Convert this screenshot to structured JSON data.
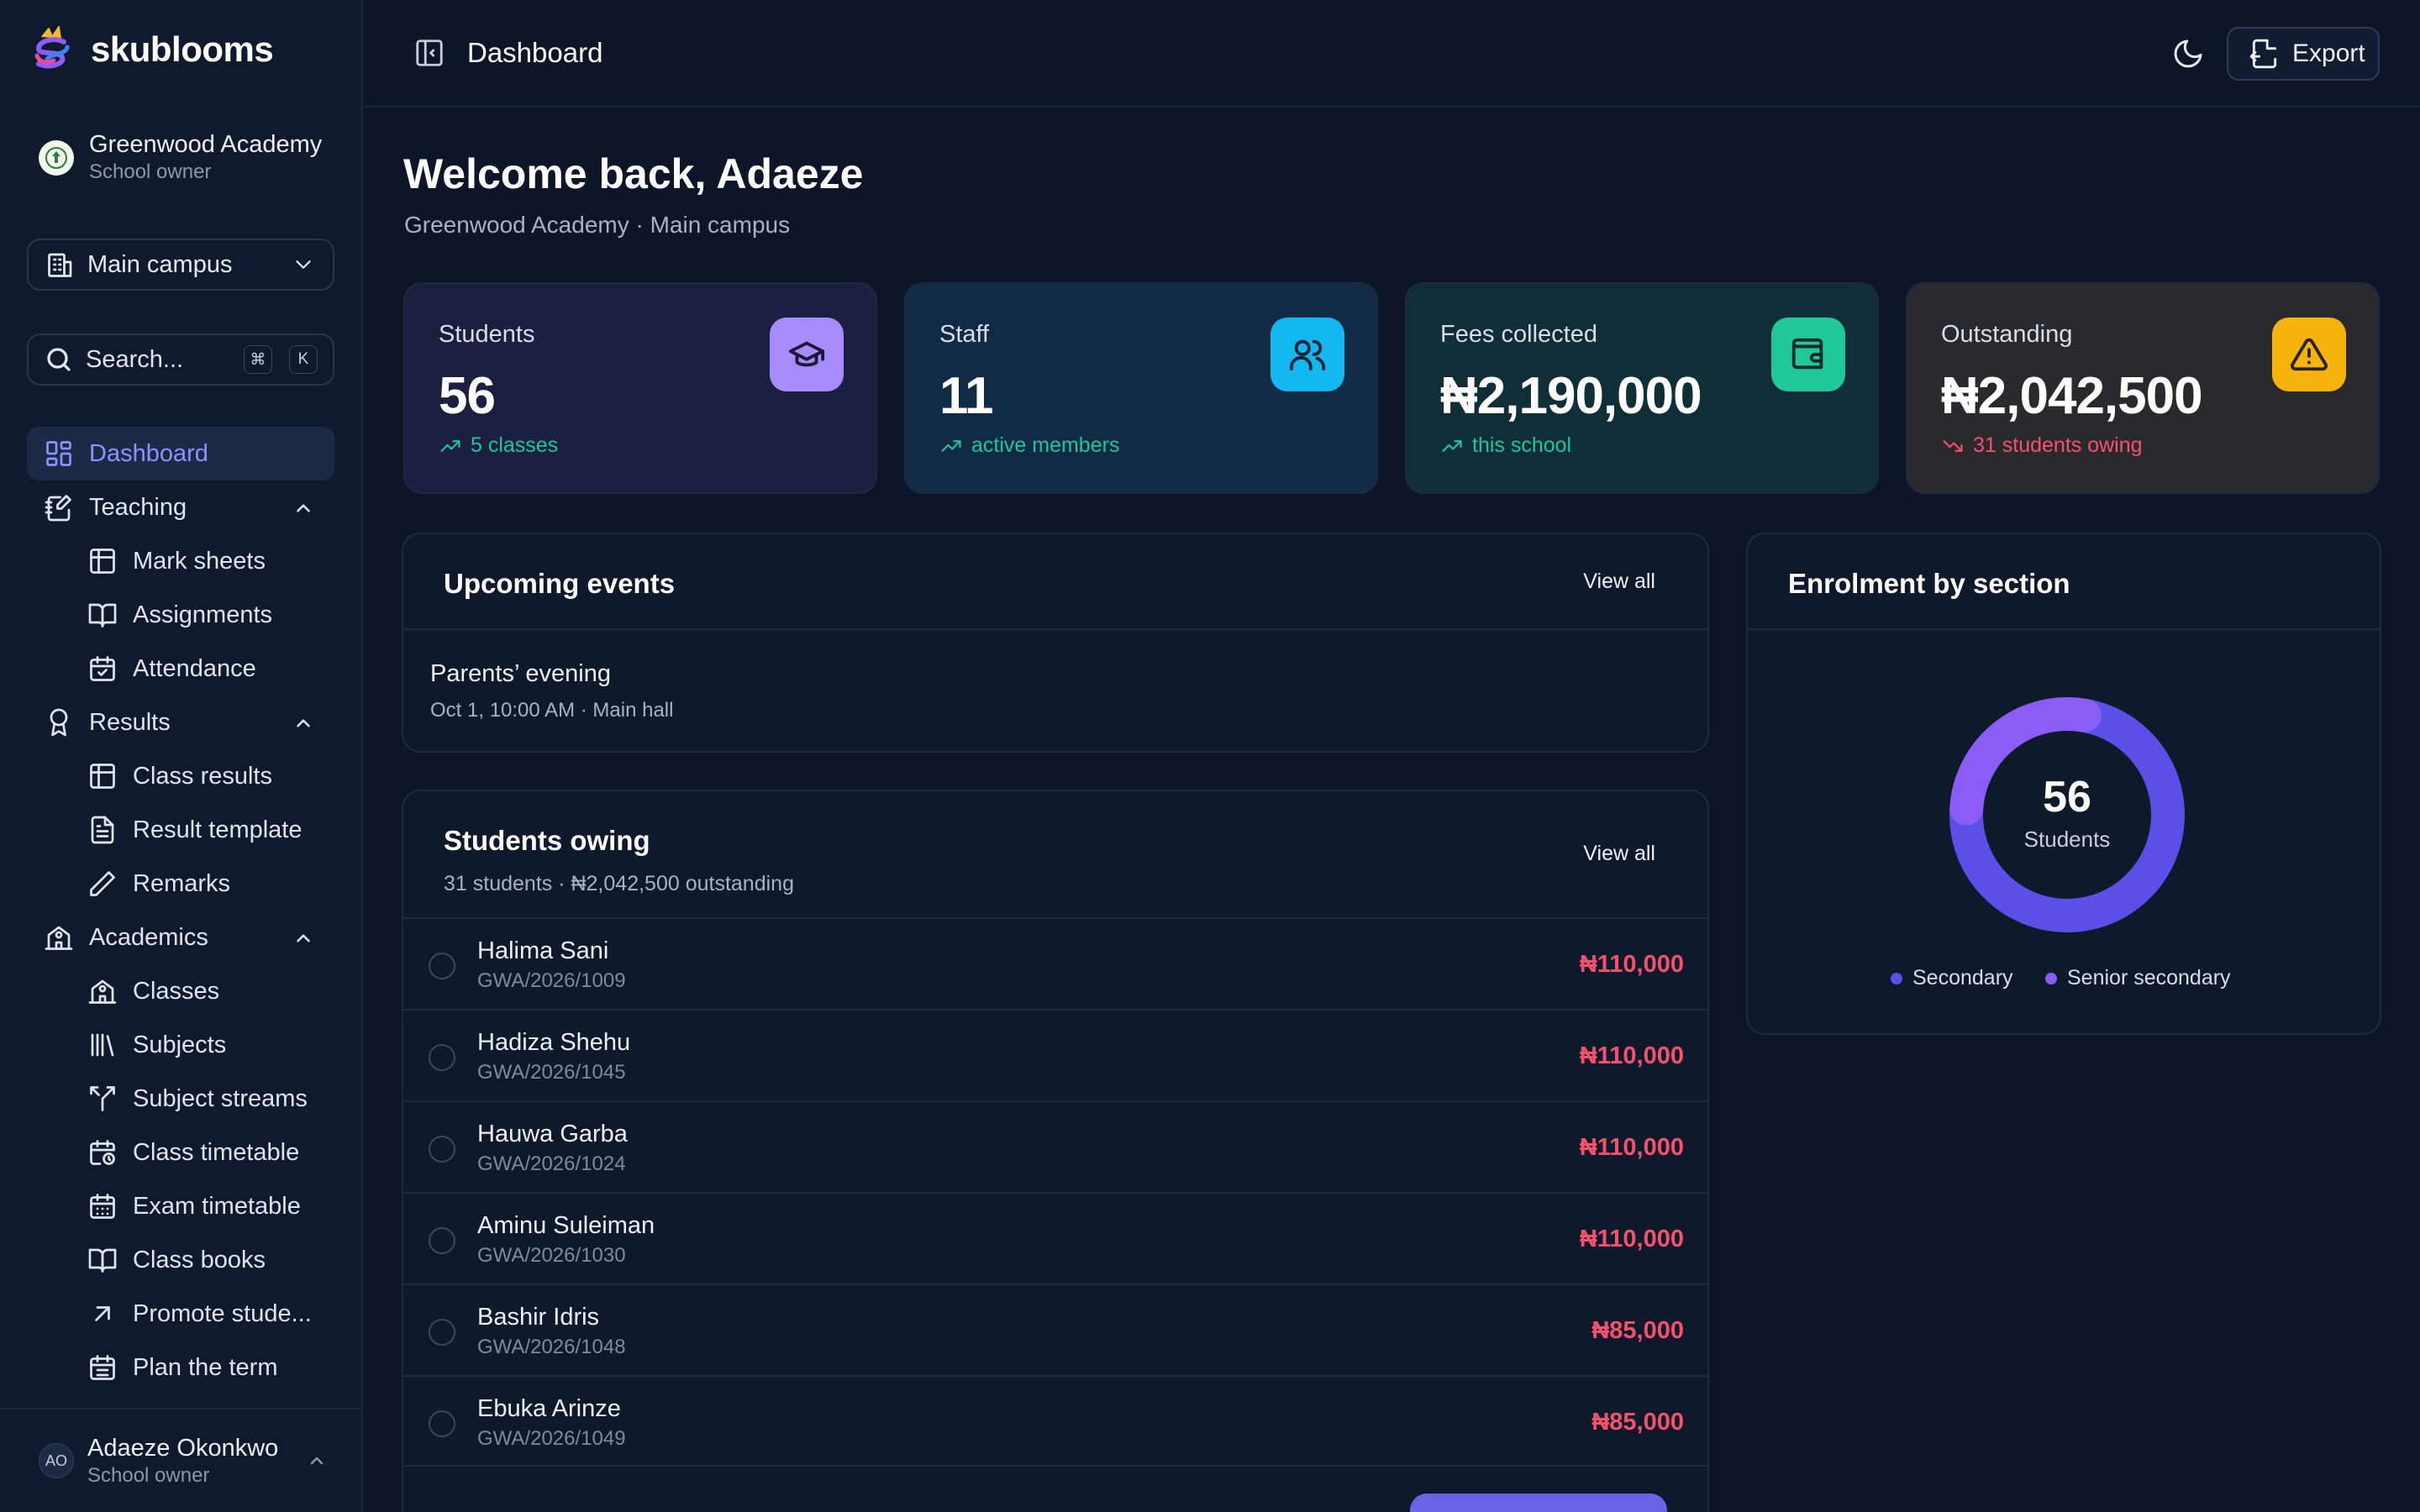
{
  "brand": {
    "name": "skublooms"
  },
  "school": {
    "name": "Greenwood Academy",
    "role": "School owner"
  },
  "campus": {
    "label": "Main campus"
  },
  "search": {
    "label": "Search...",
    "kbd1": "⌘",
    "kbd2": "K"
  },
  "nav": {
    "dashboard": "Dashboard",
    "teaching": "Teaching",
    "mark_sheets": "Mark sheets",
    "assignments": "Assignments",
    "attendance": "Attendance",
    "results": "Results",
    "class_results": "Class results",
    "result_template": "Result template",
    "remarks": "Remarks",
    "academics": "Academics",
    "classes": "Classes",
    "subjects": "Subjects",
    "subject_streams": "Subject streams",
    "class_timetable": "Class timetable",
    "exam_timetable": "Exam timetable",
    "class_books": "Class books",
    "promote_students": "Promote stude...",
    "plan_term": "Plan the term"
  },
  "user": {
    "initials": "AO",
    "name": "Adaeze Okonkwo",
    "role": "School owner"
  },
  "topbar": {
    "title": "Dashboard",
    "export_label": "Export"
  },
  "welcome": {
    "title": "Welcome back, Adaeze",
    "subtitle": "Greenwood Academy · Main campus"
  },
  "stats": [
    {
      "label": "Students",
      "value": "56",
      "trend": "5 classes",
      "trend_color": "#22c59a"
    },
    {
      "label": "Staff",
      "value": "11",
      "trend": "active members",
      "trend_color": "#22c59a"
    },
    {
      "label": "Fees collected",
      "value": "₦2,190,000",
      "trend": "this school",
      "trend_color": "#22c59a"
    },
    {
      "label": "Outstanding",
      "value": "₦2,042,500",
      "trend": "31 students owing",
      "trend_color": "#f4516c"
    }
  ],
  "events": {
    "title": "Upcoming events",
    "view_all": "View all",
    "items": [
      {
        "title": "Parents’ evening",
        "meta": "Oct 1, 10:00 AM · Main hall"
      }
    ]
  },
  "owing": {
    "title": "Students owing",
    "subtitle": "31 students · ₦2,042,500 outstanding",
    "view_all": "View all",
    "rows": [
      {
        "name": "Halima Sani",
        "id": "GWA/2026/1009",
        "amount": "₦110,000"
      },
      {
        "name": "Hadiza Shehu",
        "id": "GWA/2026/1045",
        "amount": "₦110,000"
      },
      {
        "name": "Hauwa Garba",
        "id": "GWA/2026/1024",
        "amount": "₦110,000"
      },
      {
        "name": "Aminu Suleiman",
        "id": "GWA/2026/1030",
        "amount": "₦110,000"
      },
      {
        "name": "Bashir Idris",
        "id": "GWA/2026/1048",
        "amount": "₦85,000"
      },
      {
        "name": "Ebuka Arinze",
        "id": "GWA/2026/1049",
        "amount": "₦85,000"
      }
    ]
  },
  "enrolment": {
    "title": "Enrolment by section",
    "total": "56",
    "total_label": "Students"
  },
  "chart_data": {
    "type": "pie",
    "categories": [
      "Secondary",
      "Senior secondary"
    ],
    "values": [
      41,
      15
    ],
    "colors": [
      "#5b4fe6",
      "#8b5cf6"
    ],
    "legend": "bottom"
  }
}
